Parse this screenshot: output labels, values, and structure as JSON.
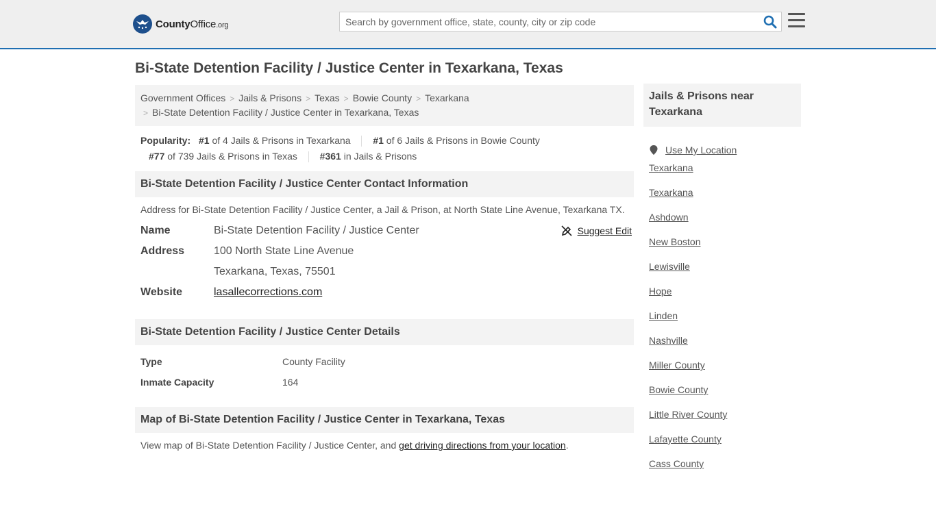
{
  "header": {
    "logo": {
      "brand_bold": "County",
      "brand_rest": "Office",
      "tld": ".org"
    },
    "search_placeholder": "Search by government office, state, county, city or zip code",
    "accent_color": "#1f6fb2"
  },
  "page_title": "Bi-State Detention Facility / Justice Center in Texarkana, Texas",
  "breadcrumb": [
    "Government Offices",
    "Jails & Prisons",
    "Texas",
    "Bowie County",
    "Texarkana",
    "Bi-State Detention Facility / Justice Center in Texarkana, Texas"
  ],
  "popularity": {
    "label": "Popularity:",
    "items": [
      {
        "rank": "#1",
        "text": " of 4 Jails & Prisons in Texarkana"
      },
      {
        "rank": "#1",
        "text": " of 6 Jails & Prisons in Bowie County"
      },
      {
        "rank": "#77",
        "text": " of 739 Jails & Prisons in Texas"
      },
      {
        "rank": "#361",
        "text": " in Jails & Prisons"
      }
    ]
  },
  "contact": {
    "heading": "Bi-State Detention Facility / Justice Center Contact Information",
    "description": "Address for Bi-State Detention Facility / Justice Center, a Jail & Prison, at North State Line Avenue, Texarkana TX.",
    "name_label": "Name",
    "name_value": "Bi-State Detention Facility / Justice Center",
    "address_label": "Address",
    "address_line1": "100 North State Line Avenue",
    "address_line2": "Texarkana, Texas, 75501",
    "website_label": "Website",
    "website_value": "lasallecorrections.com",
    "suggest_edit": "Suggest Edit"
  },
  "details": {
    "heading": "Bi-State Detention Facility / Justice Center Details",
    "rows": [
      {
        "label": "Type",
        "value": "County Facility"
      },
      {
        "label": "Inmate Capacity",
        "value": "164"
      }
    ]
  },
  "map": {
    "heading": "Map of Bi-State Detention Facility / Justice Center in Texarkana, Texas",
    "text_before": "View map of Bi-State Detention Facility / Justice Center, and ",
    "link": "get driving directions from your location",
    "text_after": "."
  },
  "sidebar": {
    "heading": "Jails & Prisons near Texarkana",
    "use_location": "Use My Location",
    "items": [
      "Texarkana",
      "Texarkana",
      "Ashdown",
      "New Boston",
      "Lewisville",
      "Hope",
      "Linden",
      "Nashville",
      "Miller County",
      "Bowie County",
      "Little River County",
      "Lafayette County",
      "Cass County"
    ]
  }
}
